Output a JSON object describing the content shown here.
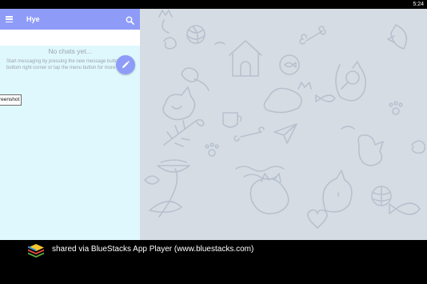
{
  "status_bar": {
    "time": "5:24"
  },
  "app": {
    "title": "Hye"
  },
  "empty_state": {
    "title": "No chats yet...",
    "description": "Start messaging by pressing the new message button in the bottom right corner or tap the menu button for more options."
  },
  "tooltip": {
    "label": "reenshot"
  },
  "share_bar": {
    "text": "shared via BlueStacks App Player (www.bluestacks.com)"
  },
  "colors": {
    "header": "#8e9cf8",
    "panel": "#dff8fd",
    "pattern_bg": "#d6dce3",
    "pattern_stroke": "#b7c2cf"
  },
  "icons": {
    "menu": "hamburger-menu-icon",
    "search": "search-icon",
    "fab": "pencil-icon",
    "logo": "bluestacks-logo"
  }
}
